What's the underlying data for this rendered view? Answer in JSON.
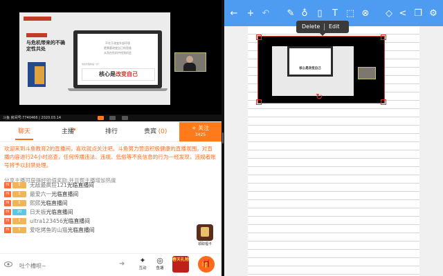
{
  "video": {
    "slide_title": "与危机带来的不确定性共处",
    "laptop_lines": [
      "不在于改变外部环境",
      "更需要改变自己的思维",
      "从而在危机中找到机会"
    ],
    "laptop_question": "危机管理的第一步？",
    "laptop_answer_prefix": "核心是",
    "laptop_answer_highlight": "改变自己",
    "status_bar": "斗鱼 房间号:7740466 | 2020.03.14"
  },
  "tabs": {
    "chat": "聊天",
    "host": "主播",
    "rank": "排行",
    "vip": "贵宾",
    "vip_count": "(0)",
    "follow_label": "+ 关注",
    "follow_count": "3425"
  },
  "chat": {
    "system_message": "欢迎来到斗鱼教育2的直播间，喜欢就点关注吧。斗鱼努力营造积极健康的直播氛围，对直播内容进行24小时巡查，任何传播违法、违规、低俗等不良信息的行为一经发现，违规者账号将予以封禁处理。",
    "share_hint": "分享主播可获得经验值奖励,并且帮主播增加热度",
    "rows": [
      {
        "level": "5",
        "level_color": "#f0b45a",
        "user": "无敌最疯狂121",
        "suffix": "光临直播间"
      },
      {
        "level": "3",
        "level_color": "#f0b45a",
        "user": "最爱六一",
        "suffix": "光临直播间"
      },
      {
        "level": "5",
        "level_color": "#f0b45a",
        "user": "熙熙",
        "suffix": "光临直播间"
      },
      {
        "level": "20",
        "level_color": "#5ac8e0",
        "user": "日天振",
        "suffix": "光临直播间"
      },
      {
        "level": "1",
        "level_color": "#f0b45a",
        "user": "ultra123456",
        "suffix": "光临直播间"
      },
      {
        "level": "5",
        "level_color": "#f0b45a",
        "user": "爱吃烤鱼的山猫",
        "suffix": "光临直播间"
      }
    ],
    "hi_label": "Hi",
    "gift_card_label": "領取福卡"
  },
  "bottom": {
    "input_placeholder": "吐个槽呗~",
    "interact_label": "互动",
    "fishball_label": "鱼塘",
    "big_gift_text": "春天礼物",
    "send_glyph": "➜"
  },
  "notes": {
    "popup_delete": "Delete",
    "popup_edit": "Edit",
    "clip_text": "核心是改变自己"
  },
  "colors": {
    "accent": "#ff6a1a",
    "toolbar": "#4e9cf2",
    "selection": "#d23a2a"
  }
}
